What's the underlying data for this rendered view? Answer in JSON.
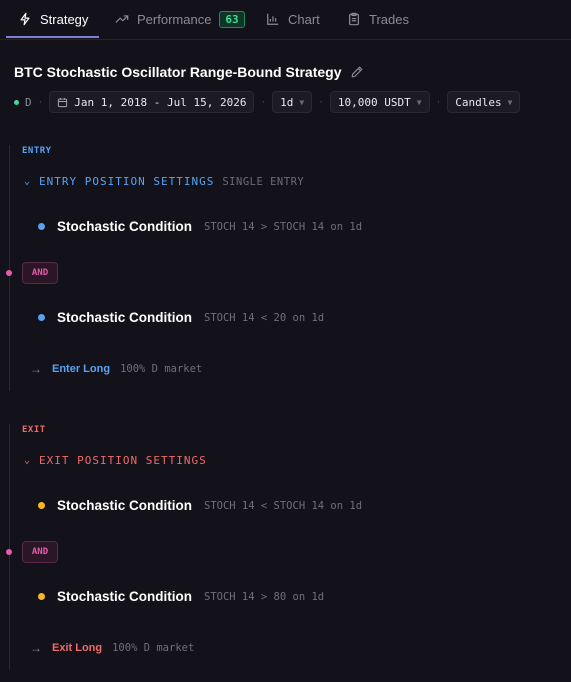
{
  "tabs": [
    {
      "label": "Strategy",
      "icon": "lightning-icon",
      "active": true
    },
    {
      "label": "Performance",
      "icon": "trend-icon",
      "badge": "63"
    },
    {
      "label": "Chart",
      "icon": "chart-icon"
    },
    {
      "label": "Trades",
      "icon": "clipboard-icon"
    }
  ],
  "header": {
    "title": "BTC Stochastic Oscillator Range-Bound Strategy",
    "status_letter": "D",
    "date_range": "Jan 1, 2018 - Jul 15, 2026",
    "timeframe": "1d",
    "capital": "10,000 USDT",
    "chart_type": "Candles"
  },
  "entry": {
    "section_label": "ENTRY",
    "settings_label": "ENTRY POSITION SETTINGS",
    "settings_sub": "SINGLE ENTRY",
    "conditions": [
      {
        "name": "Stochastic Condition",
        "expr": "STOCH 14 > STOCH 14 on 1d"
      },
      {
        "name": "Stochastic Condition",
        "expr": "STOCH 14 < 20 on 1d"
      }
    ],
    "connector": "AND",
    "action_label": "Enter Long",
    "action_detail": "100% D market"
  },
  "exit": {
    "section_label": "EXIT",
    "settings_label": "EXIT POSITION SETTINGS",
    "conditions": [
      {
        "name": "Stochastic Condition",
        "expr": "STOCH 14 < STOCH 14 on 1d"
      },
      {
        "name": "Stochastic Condition",
        "expr": "STOCH 14 > 80 on 1d"
      }
    ],
    "connector": "AND",
    "action_label": "Exit Long",
    "action_detail": "100% D market"
  },
  "colors": {
    "background": "#13121a",
    "entry_accent": "#5aa2f0",
    "exit_accent": "#f06a6a",
    "exit_bullet": "#f5b820",
    "and_accent": "#e85ab0",
    "active_tab": "#7b7fd6",
    "badge_green": "#3ddc97"
  }
}
